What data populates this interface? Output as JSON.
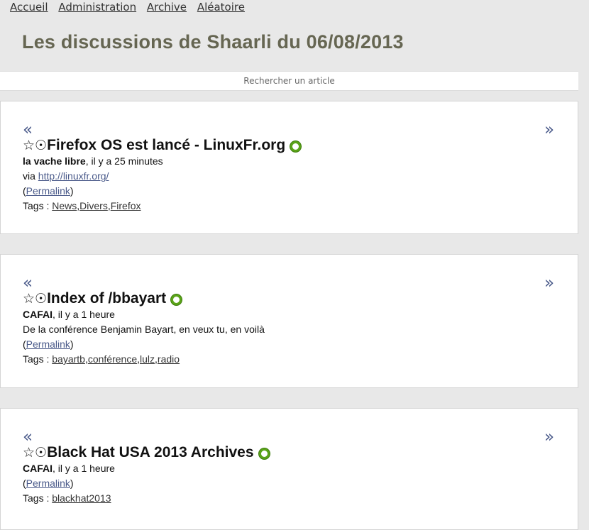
{
  "nav": {
    "items": [
      "Accueil",
      "Administration",
      "Archive",
      "Aléatoire"
    ]
  },
  "header": {
    "title": "Les discussions de Shaarli du 06/08/2013"
  },
  "search": {
    "placeholder": "Rechercher un article"
  },
  "articles": [
    {
      "prev": "«",
      "next": "»",
      "star": "☆",
      "dot": "☉",
      "title": "Firefox OS est lancé - LinuxFr.org",
      "author": "la vache libre",
      "time": ", il y a 25 minutes",
      "via_label": "via ",
      "via_link": "http://linuxfr.org/",
      "permalink": "Permalink",
      "tags_label": "Tags : ",
      "tags": [
        "News",
        "Divers",
        "Firefox"
      ]
    },
    {
      "prev": "«",
      "next": "»",
      "star": "☆",
      "dot": "☉",
      "title": "Index of /bbayart",
      "author": "CAFAI",
      "time": ", il y a 1 heure",
      "description": "De la conférence Benjamin Bayart, en veux tu, en voilà",
      "permalink": "Permalink",
      "tags_label": "Tags : ",
      "tags": [
        "bayartb",
        "conférence",
        "lulz",
        "radio"
      ]
    },
    {
      "prev": "«",
      "next": "»",
      "star": "☆",
      "dot": "☉",
      "title": "Black Hat USA 2013 Archives",
      "author": "CAFAI",
      "time": ", il y a 1 heure",
      "permalink": "Permalink",
      "tags_label": "Tags : ",
      "tags": [
        "blackhat2013"
      ]
    }
  ],
  "colors": {
    "link": "#4a5a8a",
    "title": "#666652",
    "indicator": "#5aa318"
  }
}
